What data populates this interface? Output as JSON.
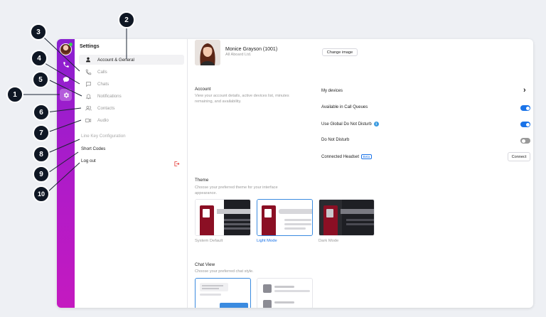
{
  "settings": {
    "title": "Settings",
    "nav_items": [
      {
        "label": "Account & General",
        "icon": "person-icon"
      },
      {
        "label": "Calls",
        "icon": "phone-icon"
      },
      {
        "label": "Chats",
        "icon": "chat-bubble-icon"
      },
      {
        "label": "Notifications",
        "icon": "bell-icon"
      },
      {
        "label": "Contacts",
        "icon": "contacts-icon"
      },
      {
        "label": "Audio",
        "icon": "video-icon"
      }
    ],
    "line_key": "Line Key Configuration",
    "short_codes": "Short Codes",
    "log_out": "Log out"
  },
  "profile": {
    "name": "Monice Grayson (1001)",
    "company": "All Aboard Ltd.",
    "change_image": "Change image"
  },
  "account": {
    "title": "Account",
    "description": "View your account details, active devices list, minutes remaining, and availability.",
    "my_devices": "My devices",
    "available_in_call_queues": "Available in Call Queues",
    "use_global_dnd": "Use Global Do Not Disturb",
    "info_glyph": "i",
    "do_not_disturb": "Do Not Disturb",
    "connected_headset": "Connected Headset",
    "beta": "Beta",
    "connect": "Connect",
    "chevron": "›"
  },
  "toggles": {
    "available_in_call_queues": true,
    "use_global_dnd": true,
    "do_not_disturb": false
  },
  "theme": {
    "title": "Theme",
    "description": "Choose your preferred theme for your interface appearance.",
    "options": [
      "System Default",
      "Light Mode",
      "Dark Mode"
    ],
    "selected": "Light Mode"
  },
  "chat_view": {
    "title": "Chat View",
    "description": "Choose your preferred chat style."
  },
  "callouts": [
    "1",
    "2",
    "3",
    "4",
    "5",
    "6",
    "7",
    "8",
    "9",
    "10"
  ],
  "colors": {
    "rail_gradient_start": "#8a1fd0",
    "rail_gradient_end": "#c41ac0",
    "accent_blue": "#1a73e8",
    "brand_maroon": "#8b0f24",
    "callout_dark": "#0f1724",
    "presence_green": "#39d353"
  }
}
